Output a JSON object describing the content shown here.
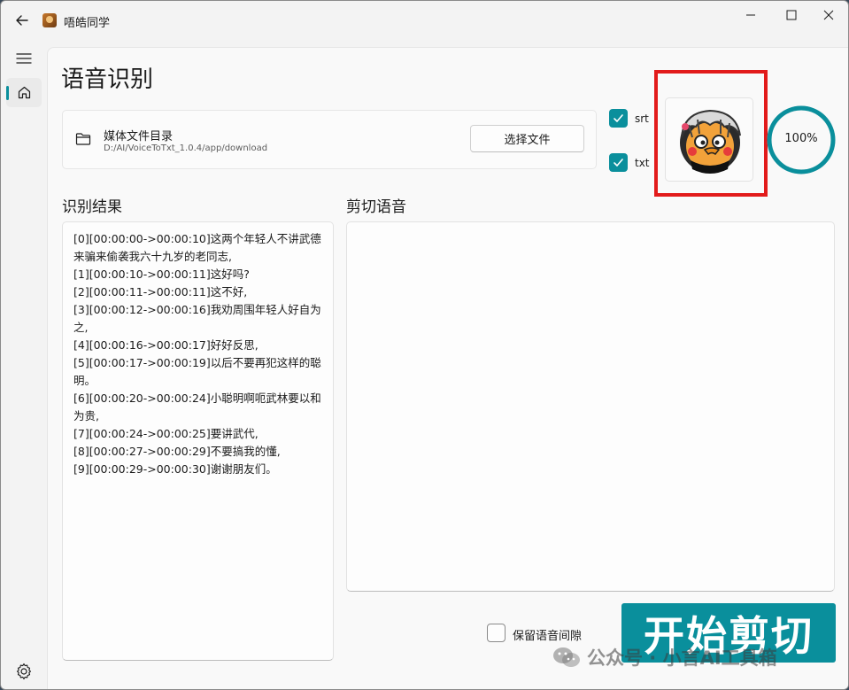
{
  "window": {
    "title": "唔皓同学"
  },
  "page": {
    "title": "语音识别"
  },
  "media": {
    "label": "媒体文件目录",
    "path": "D:/AI/VoiceToTxt_1.0.4/app/download",
    "choose_button": "选择文件"
  },
  "options": {
    "srt": {
      "label": "srt",
      "checked": true
    },
    "txt": {
      "label": "txt",
      "checked": true
    },
    "keep_gap": {
      "label": "保留语音间隙",
      "checked": false
    }
  },
  "progress": {
    "value": 1.0,
    "label": "100%"
  },
  "results": {
    "title": "识别结果",
    "lines": [
      "[0][00:00:00->00:00:10]这两个年轻人不讲武德来骗来偷袭我六十九岁的老同志,",
      "[1][00:00:10->00:00:11]这好吗?",
      "[2][00:00:11->00:00:11]这不好,",
      "[3][00:00:12->00:00:16]我劝周围年轻人好自为之,",
      "[4][00:00:16->00:00:17]好好反思,",
      "[5][00:00:17->00:00:19]以后不要再犯这样的聪明。",
      "[6][00:00:20->00:00:24]小聪明啊呃武林要以和为贵,",
      "[7][00:00:24->00:00:25]要讲武代,",
      "[8][00:00:27->00:00:29]不要搞我的懂,",
      "[9][00:00:29->00:00:30]谢谢朋友们。"
    ]
  },
  "cut": {
    "title": "剪切语音",
    "start_button": "开始剪切"
  },
  "watermark": {
    "text": "公众号 · 小言AI工具箱"
  },
  "colors": {
    "accent": "#0a8f9c",
    "highlight": "#e21b1b"
  },
  "icons": {
    "back": "back-arrow-icon",
    "menu": "hamburger-menu-icon",
    "home": "home-icon",
    "settings": "gear-icon",
    "folder": "folder-icon"
  }
}
